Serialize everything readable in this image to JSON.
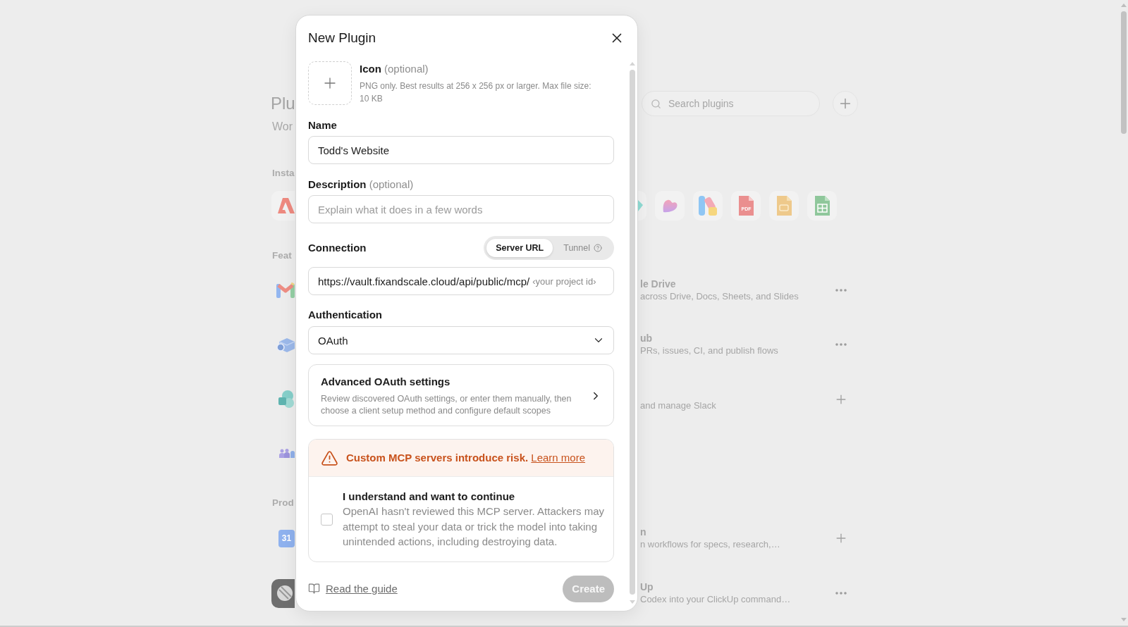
{
  "page": {
    "title": "Plu",
    "subtitle": "Wor",
    "search": {
      "placeholder": "Search plugins"
    },
    "installed": {
      "heading": "Insta",
      "apps_left": [
        {
          "kind": "triangle"
        }
      ],
      "apps_right": [
        {
          "kind": "gem"
        },
        {
          "kind": "heart"
        },
        {
          "kind": "blocks"
        },
        {
          "kind": "pdf",
          "label": "PDF"
        },
        {
          "kind": "doc"
        },
        {
          "kind": "sheet"
        }
      ]
    },
    "featured": {
      "heading": "Feat",
      "icons_left": [
        {
          "kind": "envelope"
        },
        {
          "kind": "box"
        },
        {
          "kind": "circles"
        },
        {
          "kind": "people"
        }
      ],
      "rows_right": [
        {
          "name": "le Drive",
          "description": "across Drive, Docs, Sheets, and Slides",
          "kind": "more"
        },
        {
          "name": "ub",
          "description": "PRs, issues, CI, and publish flows",
          "kind": "more"
        },
        {
          "description": "and manage Slack",
          "kind": "add"
        }
      ]
    },
    "productivity": {
      "heading": "Prod",
      "icons_left": [
        {
          "kind": "calendar",
          "label": "31"
        },
        {
          "kind": "tile"
        }
      ],
      "rows_right": [
        {
          "name": "n",
          "description": "n workflows for specs, research,…",
          "kind": "add"
        },
        {
          "name": "Up",
          "description": "Codex into your ClickUp command…",
          "kind": "more"
        }
      ]
    }
  },
  "dialog": {
    "title": "New Plugin",
    "icon_upload": {
      "label": "Icon",
      "note": "(optional)",
      "hint": "PNG only. Best results at 256 x 256 px or larger. Max file size: 10 KB"
    },
    "name": {
      "label": "Name",
      "value": "Todd's Website"
    },
    "description": {
      "label": "Description",
      "note": "(optional)",
      "placeholder": "Explain what it does in a few words"
    },
    "connection": {
      "label": "Connection",
      "modes": [
        {
          "label": "Server URL",
          "selected": true,
          "help": false
        },
        {
          "label": "Tunnel",
          "selected": false,
          "help": true
        }
      ],
      "url": {
        "prefix": "https://vault.fixandscale.cloud/api/public/mcp/",
        "placeholder": "‹your project id›"
      }
    },
    "authentication": {
      "label": "Authentication",
      "value": "OAuth"
    },
    "advanced": {
      "title": "Advanced OAuth settings",
      "description": "Review discovered OAuth settings, or enter them manually, then choose a client setup method and configure default scopes"
    },
    "warning": {
      "message": "Custom MCP servers introduce risk.",
      "link": "Learn more"
    },
    "consent": {
      "checked": false,
      "title": "I understand and want to continue",
      "description": "OpenAI hasn't reviewed this MCP server. Attackers may attempt to steal your data or trick the model into taking unintended actions, including destroying data."
    },
    "footer": {
      "guide_link": "Read the guide",
      "create": {
        "label": "Create",
        "disabled": true
      }
    }
  }
}
